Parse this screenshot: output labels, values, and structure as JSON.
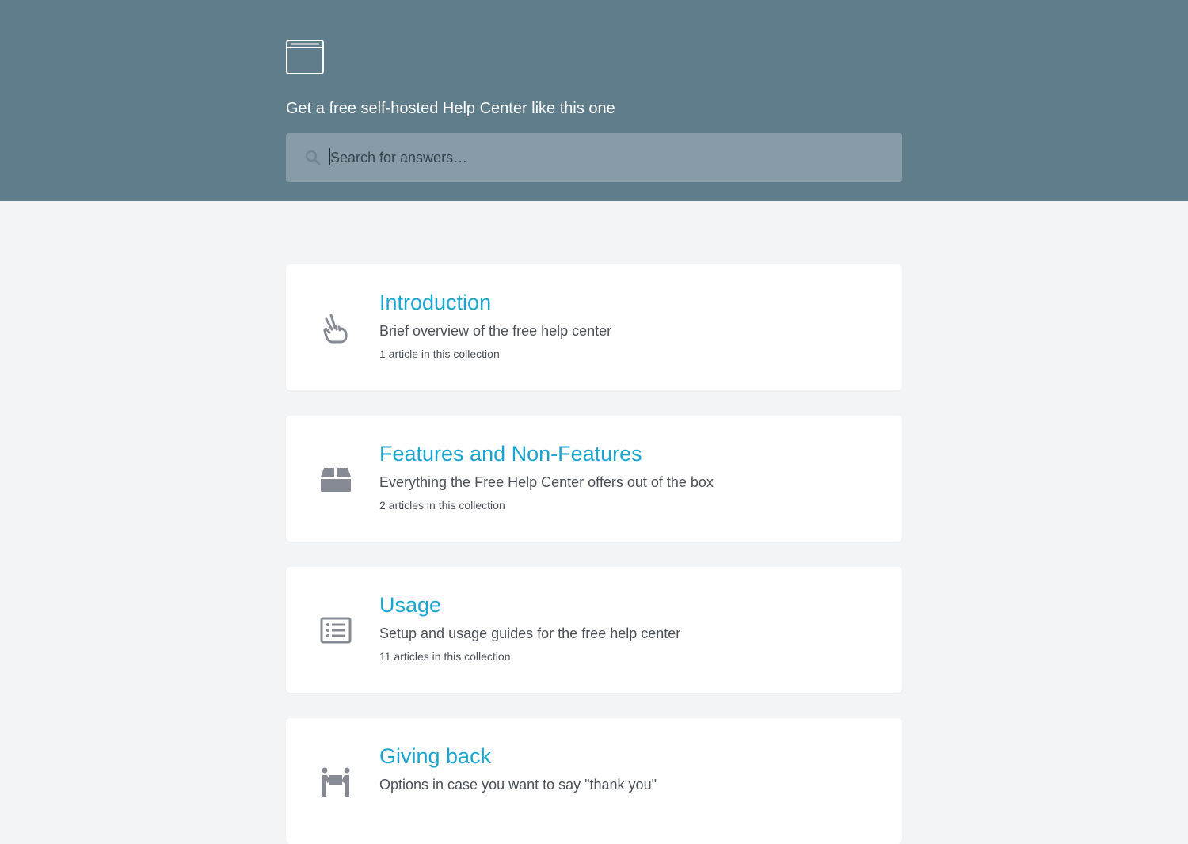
{
  "header": {
    "logo_icon": "browser-window-icon",
    "tagline": "Get a free self-hosted Help Center like this one",
    "background_color": "#607d8b"
  },
  "search": {
    "icon": "search-icon",
    "placeholder": "Search for answers…",
    "value": ""
  },
  "collections": [
    {
      "icon": "peace-hand-icon",
      "title": "Introduction",
      "description": "Brief overview of the free help center",
      "count": "1 article in this collection"
    },
    {
      "icon": "box-icon",
      "title": "Features and Non-Features",
      "description": "Everything the Free Help Center offers out of the box",
      "count": "2 articles in this collection"
    },
    {
      "icon": "list-icon",
      "title": "Usage",
      "description": "Setup and usage guides for the free help center",
      "count": "11 articles in this collection"
    },
    {
      "icon": "people-carry-icon",
      "title": "Giving back",
      "description": "Options in case you want to say \"thank you\"",
      "count": ""
    }
  ],
  "colors": {
    "accent": "#1aa5d1",
    "page_background": "#f3f4f6",
    "search_background": "#879ca6",
    "icon_gray": "#858a94"
  }
}
